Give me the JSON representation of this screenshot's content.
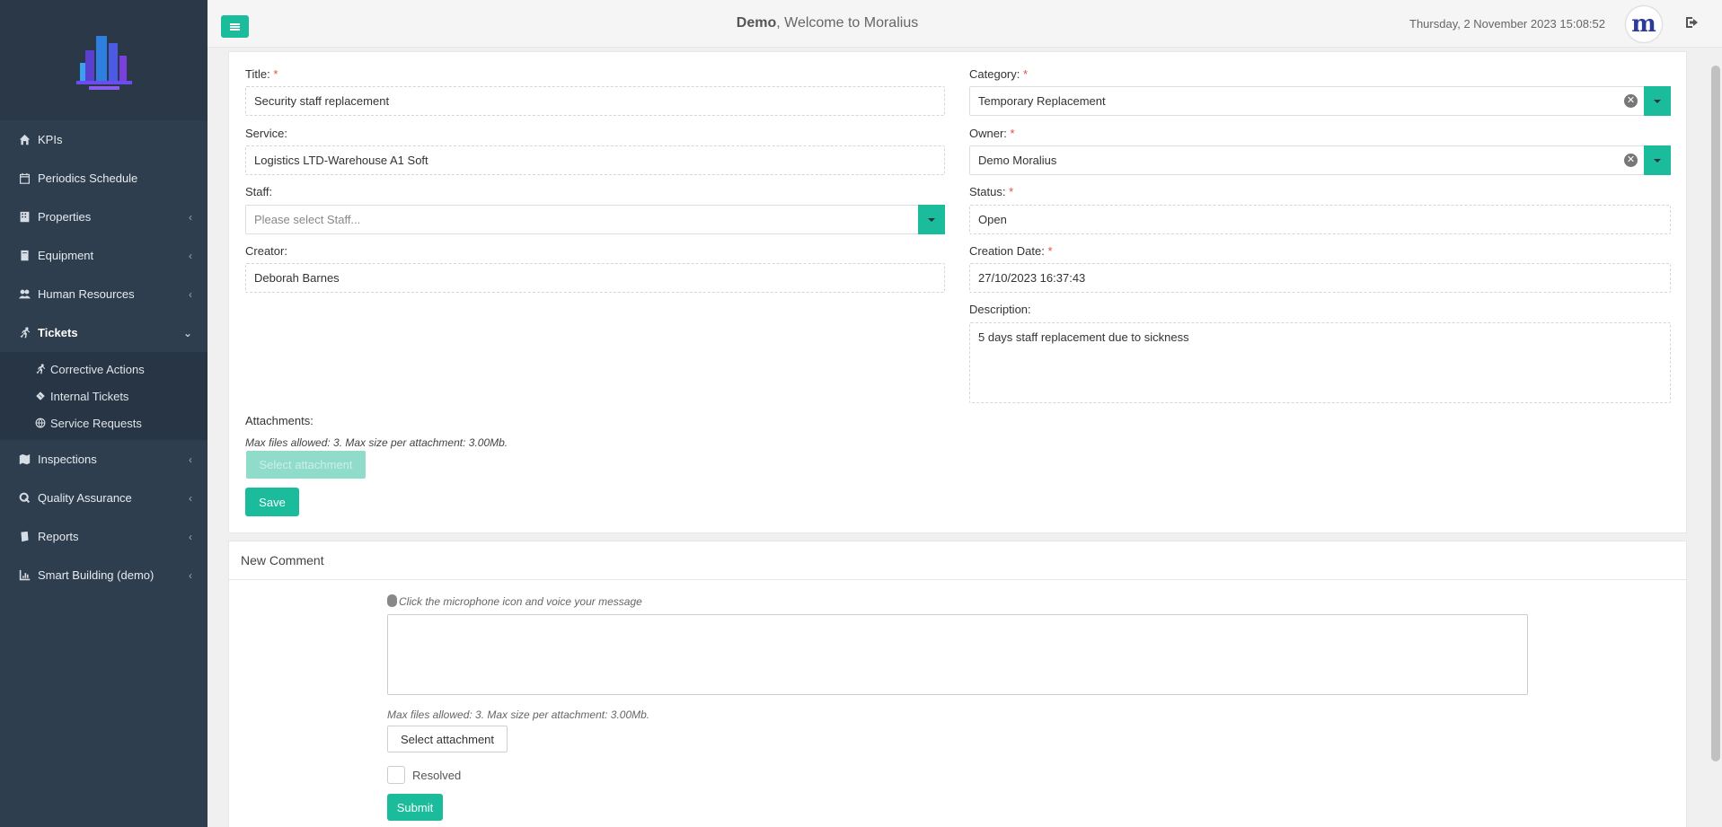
{
  "sidebar": {
    "items": [
      {
        "label": "KPIs",
        "icon": "home-icon"
      },
      {
        "label": "Periodics Schedule",
        "icon": "calendar-icon"
      },
      {
        "label": "Properties",
        "icon": "building-icon"
      },
      {
        "label": "Equipment",
        "icon": "book-icon"
      },
      {
        "label": "Human Resources",
        "icon": "users-icon"
      },
      {
        "label": "Tickets",
        "icon": "running-icon"
      },
      {
        "label": "Inspections",
        "icon": "map-icon"
      },
      {
        "label": "Quality Assurance",
        "icon": "q-icon"
      },
      {
        "label": "Reports",
        "icon": "reports-book-icon"
      },
      {
        "label": "Smart Building (demo)",
        "icon": "chart-icon"
      }
    ],
    "ticket_subitems": [
      {
        "label": "Corrective Actions",
        "icon": "running-icon"
      },
      {
        "label": "Internal Tickets",
        "icon": "ticket-icon"
      },
      {
        "label": "Service Requests",
        "icon": "globe-icon"
      }
    ]
  },
  "header": {
    "user": "Demo",
    "welcome_suffix": ", Welcome to Moralius",
    "datetime": "Thursday, 2 November 2023 15:08:52",
    "avatar_letter": "m"
  },
  "form": {
    "title_label": "Title:",
    "title_value": "Security staff replacement",
    "service_label": "Service:",
    "service_value": "Logistics LTD-Warehouse A1 Soft",
    "staff_label": "Staff:",
    "staff_placeholder": "Please select Staff...",
    "creator_label": "Creator:",
    "creator_value": "Deborah Barnes",
    "category_label": "Category:",
    "category_value": "Temporary Replacement",
    "owner_label": "Owner:",
    "owner_value": "Demo Moralius",
    "status_label": "Status:",
    "status_value": "Open",
    "creation_date_label": "Creation Date:",
    "creation_date_value": "27/10/2023 16:37:43",
    "description_label": "Description:",
    "description_value": "5 days staff replacement due to sickness",
    "attachments_label": "Attachments:",
    "attachments_hint": "Max files allowed: 3. Max size per attachment: 3.00Mb.",
    "select_attachment_label": "Select attachment",
    "save_label": "Save",
    "required_mark": "*"
  },
  "comment": {
    "heading": "New Comment",
    "voice_hint": "Click the microphone icon and voice your message",
    "attachments_hint": "Max files allowed: 3. Max size per attachment: 3.00Mb.",
    "select_attachment_label": "Select attachment",
    "resolved_label": "Resolved",
    "submit_label": "Submit"
  },
  "colors": {
    "accent": "#1abc9c",
    "sidebar_bg": "#2f3e4e",
    "required": "#e74c3c"
  }
}
